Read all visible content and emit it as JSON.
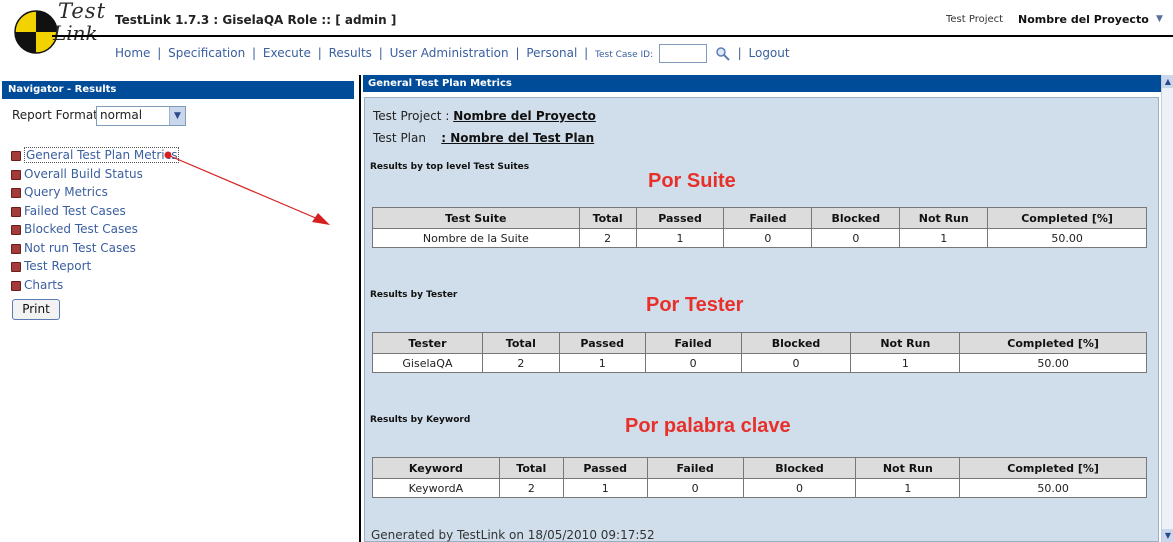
{
  "window": {
    "app_title": "TestLink 1.7.3 : GiselaQA Role :: [ admin ]",
    "project_label": "Test Project",
    "project_name": "Nombre del Proyecto"
  },
  "logo": {
    "line1": "Test",
    "line2": "Link"
  },
  "menu": {
    "home": "Home",
    "specification": "Specification",
    "execute": "Execute",
    "results": "Results",
    "user_admin": "User Administration",
    "personal": "Personal",
    "tcid_label": "Test Case ID:",
    "logout": "Logout",
    "separator": "|"
  },
  "navigator": {
    "title": "Navigator - Results",
    "report_format_label": "Report Format",
    "report_format_value": "normal",
    "items": [
      "General Test Plan Metrics",
      "Overall Build Status",
      "Query Metrics",
      "Failed Test Cases",
      "Blocked Test Cases",
      "Not run Test Cases",
      "Test Report",
      "Charts"
    ],
    "print_label": "Print"
  },
  "content": {
    "title": "General Test Plan Metrics",
    "test_project_label": "Test Project :",
    "test_project_value": "Nombre del Proyecto",
    "test_plan_label": "Test Plan",
    "test_plan_value": ": Nombre del Test Plan",
    "generated": "Generated by TestLink on 18/05/2010 09:17:52",
    "sections": {
      "suite": {
        "label": "Results by top level Test Suites",
        "annotation": "Por Suite",
        "headers": [
          "Test Suite",
          "Total",
          "Passed",
          "Failed",
          "Blocked",
          "Not Run",
          "Completed [%]"
        ],
        "row": [
          "Nombre de la Suite",
          "2",
          "1",
          "0",
          "0",
          "1",
          "50.00"
        ]
      },
      "tester": {
        "label": "Results by Tester",
        "annotation": "Por Tester",
        "headers": [
          "Tester",
          "Total",
          "Passed",
          "Failed",
          "Blocked",
          "Not Run",
          "Completed [%]"
        ],
        "row": [
          "GiselaQA",
          "2",
          "1",
          "0",
          "0",
          "1",
          "50.00"
        ]
      },
      "keyword": {
        "label": "Results by Keyword",
        "annotation": "Por palabra clave",
        "headers": [
          "Keyword",
          "Total",
          "Passed",
          "Failed",
          "Blocked",
          "Not Run",
          "Completed [%]"
        ],
        "row": [
          "KeywordA",
          "2",
          "1",
          "0",
          "0",
          "1",
          "50.00"
        ]
      }
    }
  },
  "colors": {
    "title_bar": "#004c99",
    "panel_bg": "#d0deeb",
    "annotation_red": "#e8302b",
    "link_blue": "#3a5f9f"
  }
}
